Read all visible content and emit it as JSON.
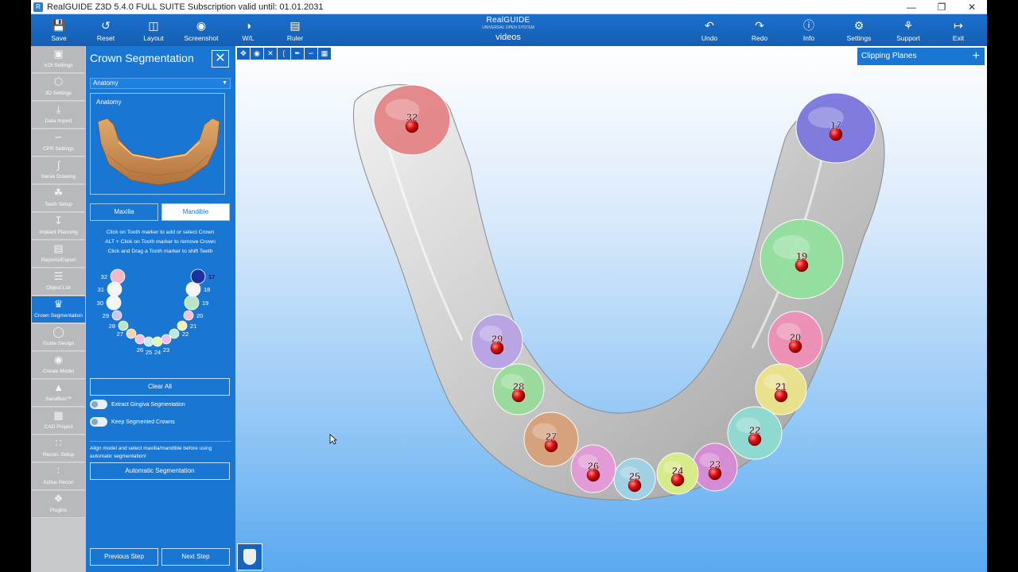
{
  "window": {
    "title": "RealGUIDE Z3D  5.4.0  FULL SUITE Subscription valid until: 01.01.2031",
    "controls": [
      "—",
      "❐",
      "✕"
    ]
  },
  "toolbar": {
    "left": [
      {
        "label": "Save",
        "icon": "save-icon"
      },
      {
        "label": "Reset",
        "icon": "reset-icon"
      },
      {
        "label": "Layout",
        "icon": "layout-icon"
      },
      {
        "label": "Screenshot",
        "icon": "camera-icon"
      },
      {
        "label": "W/L",
        "icon": "contrast-icon"
      },
      {
        "label": "Ruler",
        "icon": "ruler-icon"
      }
    ],
    "right": [
      {
        "label": "Undo",
        "icon": "undo-icon"
      },
      {
        "label": "Redo",
        "icon": "redo-icon"
      },
      {
        "label": "Info",
        "icon": "info-icon"
      },
      {
        "label": "Settings",
        "icon": "gear-icon"
      },
      {
        "label": "Support",
        "icon": "globe-icon"
      },
      {
        "label": "Exit",
        "icon": "exit-icon"
      }
    ],
    "brand": {
      "logo": "RealGUIDE",
      "logo_sub": "UNIVERSAL OPEN SYSTEM",
      "project": "videos"
    }
  },
  "rail": [
    {
      "label": "VOI Settings",
      "icon": "voi-icon"
    },
    {
      "label": "3D Settings",
      "icon": "cube-icon"
    },
    {
      "label": "Data Import",
      "icon": "download-icon"
    },
    {
      "label": "CPR Settings",
      "icon": "curve-icon"
    },
    {
      "label": "Nerve Drawing",
      "icon": "nerve-icon"
    },
    {
      "label": "Teeth Setup",
      "icon": "tooth-icon"
    },
    {
      "label": "Implant Planning",
      "icon": "implant-icon"
    },
    {
      "label": "Reports/Export",
      "icon": "report-icon"
    },
    {
      "label": "Object List",
      "icon": "list-icon"
    },
    {
      "label": "Crown Segmentation",
      "icon": "crown-icon",
      "active": true
    },
    {
      "label": "Guide Design",
      "icon": "guide-icon"
    },
    {
      "label": "Create Model",
      "icon": "model-icon"
    },
    {
      "label": "SandBox™",
      "icon": "sandbox-icon"
    },
    {
      "label": "CAD Project",
      "icon": "cad-icon"
    },
    {
      "label": "Recon. Setup",
      "icon": "recon-icon"
    },
    {
      "label": "Active Recon",
      "icon": "active-recon-icon"
    },
    {
      "label": "Plugins",
      "icon": "puzzle-icon"
    }
  ],
  "panel": {
    "title": "Crown Segmentation",
    "select_value": "Anatomy",
    "anatomy_label": "Anatomy",
    "maxilla": "Maxilla",
    "mandible": "Mandible",
    "instructions": [
      "Click on Tooth marker to add or select Crown",
      "ALT + Click on Tooth marker to remove Crown",
      "Click and Drag a Tooth marker to shift Teeth"
    ],
    "clear_all": "Clear All",
    "extract_gingiva": "Extract Gingiva Segmentation",
    "keep_segmented": "Keep Segmented Crowns",
    "align_note": "Align model and select maxilla/mandible before using automatic segmentation!",
    "automatic": "Automatic Segmentation",
    "previous": "Previous Step",
    "next": "Next Step"
  },
  "tooth_map": [
    {
      "num": "32",
      "color": "#f2b8c6"
    },
    {
      "num": "31",
      "color": "#f5f5f5"
    },
    {
      "num": "30",
      "color": "#f5f5f5"
    },
    {
      "num": "29",
      "color": "#cfc3f0"
    },
    {
      "num": "28",
      "color": "#b9e6c4"
    },
    {
      "num": "27",
      "color": "#f3d3a8"
    },
    {
      "num": "26",
      "color": "#f5c0e4"
    },
    {
      "num": "25",
      "color": "#c4ecf5"
    },
    {
      "num": "24",
      "color": "#e3f5b4"
    },
    {
      "num": "23",
      "color": "#f5c0e4"
    },
    {
      "num": "22",
      "color": "#b9ecd8"
    },
    {
      "num": "21",
      "color": "#f5f0b4"
    },
    {
      "num": "20",
      "color": "#f5bfd6"
    },
    {
      "num": "19",
      "color": "#b9e6c4"
    },
    {
      "num": "18",
      "color": "#f5f5f5"
    },
    {
      "num": "17",
      "color": "#1e2f9e"
    }
  ],
  "viewport": {
    "clipping_planes": "Clipping Planes",
    "tools": [
      "move-icon",
      "camera-icon",
      "close-icon",
      "cut-icon",
      "draw-icon",
      "curve-icon",
      "grid-icon"
    ],
    "crowns": [
      {
        "num": "32",
        "color": "#e48487"
      },
      {
        "num": "17",
        "color": "#7c78e0"
      },
      {
        "num": "19",
        "color": "#93e09e"
      },
      {
        "num": "20",
        "color": "#ef8fb7"
      },
      {
        "num": "21",
        "color": "#ece48a"
      },
      {
        "num": "22",
        "color": "#8fdcd2"
      },
      {
        "num": "23",
        "color": "#d88bd6"
      },
      {
        "num": "24",
        "color": "#d9ef86"
      },
      {
        "num": "25",
        "color": "#9fd3e6"
      },
      {
        "num": "26",
        "color": "#e59ad8"
      },
      {
        "num": "27",
        "color": "#d8a07a"
      },
      {
        "num": "28",
        "color": "#99dc9a"
      },
      {
        "num": "29",
        "color": "#b8a3e6"
      }
    ]
  }
}
